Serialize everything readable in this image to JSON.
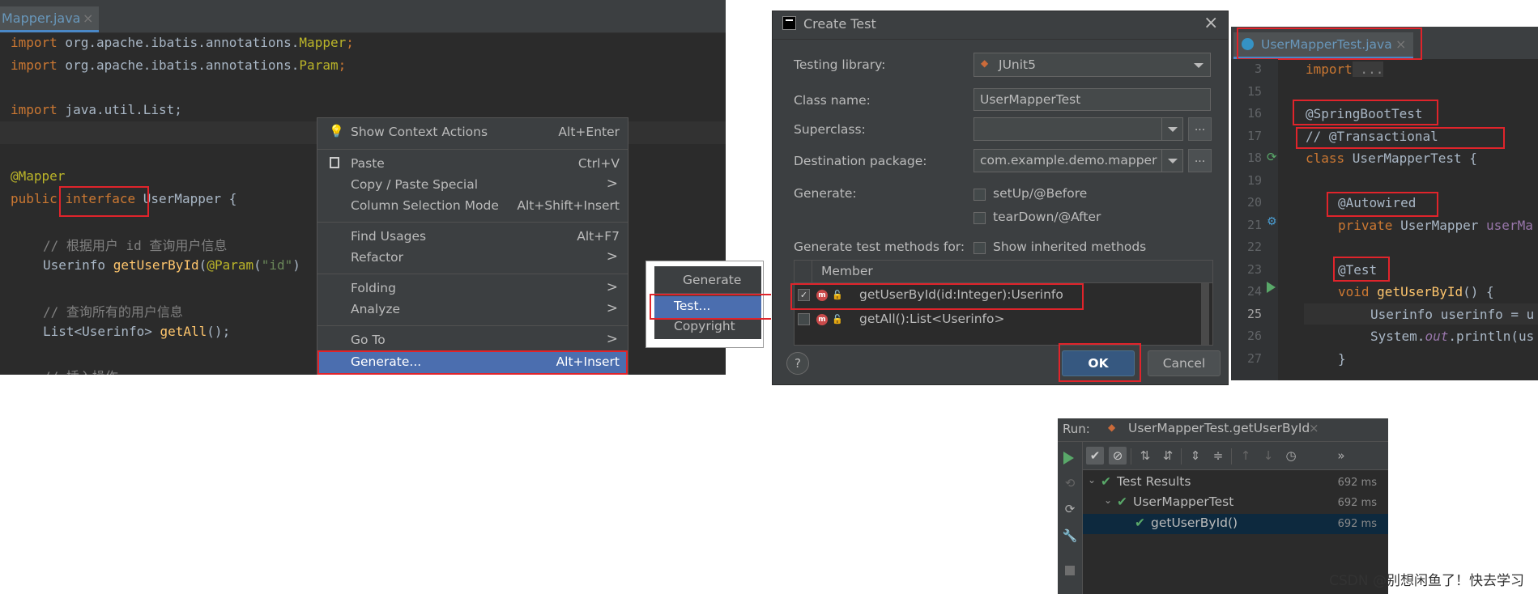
{
  "editor": {
    "tab_label": "Mapper.java",
    "tab_close": "×",
    "lines": {
      "l1_kw": "import",
      "l1_pkg": " org.apache.ibatis.annotations.",
      "l1_cls": "Mapper",
      "l1_end": ";",
      "l2_kw": "import",
      "l2_pkg": " org.apache.ibatis.annotations.",
      "l2_cls": "Param",
      "l2_end": ";",
      "l3_kw": "import",
      "l3_rest": " java.util.List;",
      "l4_ann": "@Mapper",
      "l5_kw": "public ",
      "l5_kw2": "interface",
      "l5_rest": " UserMapper {",
      "l6_cm": "// 根据用户 id 查询用户信息",
      "l7_type": "Userinfo ",
      "l7_fn": "getUserById",
      "l7_p": "(",
      "l7_ann": "@Param",
      "l7_p2": "(",
      "l7_str": "\"id\"",
      "l7_p3": ")",
      "l8_cm": "// 查询所有的用户信息",
      "l9_type": "List<Userinfo> ",
      "l9_fn": "getAll",
      "l9_end": "();",
      "l10_cm": "// 插入操作"
    }
  },
  "context_menu": {
    "items": [
      {
        "label": "Show Context Actions",
        "shortcut": "Alt+Enter"
      },
      {
        "label": "Paste",
        "shortcut": "Ctrl+V"
      },
      {
        "label": "Copy / Paste Special",
        "shortcut": ">"
      },
      {
        "label": "Column Selection Mode",
        "shortcut": "Alt+Shift+Insert"
      },
      {
        "label": "Find Usages",
        "shortcut": "Alt+F7"
      },
      {
        "label": "Refactor",
        "shortcut": ">"
      },
      {
        "label": "Folding",
        "shortcut": ">"
      },
      {
        "label": "Analyze",
        "shortcut": ">"
      },
      {
        "label": "Go To",
        "shortcut": ">"
      },
      {
        "label": "Generate...",
        "shortcut": "Alt+Insert"
      }
    ]
  },
  "generate_popup": {
    "title": "Generate",
    "items": [
      "Test...",
      "Copyright"
    ]
  },
  "dialog": {
    "title": "Create Test",
    "close": "×",
    "testing_library_label": "Testing library:",
    "testing_library_value": "JUnit5",
    "class_name_label": "Class name:",
    "class_name_value": "UserMapperTest",
    "superclass_label": "Superclass:",
    "superclass_value": "",
    "destination_label": "Destination package:",
    "destination_value": "com.example.demo.mapper",
    "ellipsis": "...",
    "generate_label": "Generate:",
    "setup_label": "setUp/@Before",
    "teardown_label": "tearDown/@After",
    "methods_label": "Generate test methods for:",
    "inherited_label": "Show inherited methods",
    "member_header": "Member",
    "members": [
      {
        "label": "getUserById(id:Integer):Userinfo",
        "checked": true
      },
      {
        "label": "getAll():List<Userinfo>",
        "checked": false
      }
    ],
    "help": "?",
    "ok_label": "OK",
    "cancel_label": "Cancel"
  },
  "test_editor": {
    "tab_label": "UserMapperTest.java",
    "tab_close": "×",
    "line_numbers": [
      "3",
      "15",
      "16",
      "17",
      "18",
      "19",
      "20",
      "21",
      "22",
      "23",
      "24",
      "25",
      "26",
      "27"
    ],
    "l3_kw": "import",
    "l3_fold": " ...",
    "l16": "@SpringBootTest",
    "l17": "// @Transactional",
    "l18_kw": "class ",
    "l18_rest": "UserMapperTest {",
    "l20": "@Autowired",
    "l21_kw": "private ",
    "l21_rest": "UserMapper ",
    "l21_var": "userMa",
    "l23": "@Test",
    "l24_kw": "void ",
    "l24_fn": "getUserById",
    "l24_rest": "() {",
    "l25": "Userinfo userinfo = u",
    "l26_a": "System.",
    "l26_b": "out",
    "l26_c": ".println(us",
    "l27": "}"
  },
  "run": {
    "label": "Run:",
    "tab_label": "UserMapperTest.getUserById",
    "tab_close": "×",
    "tree": [
      {
        "label": "Test Results",
        "time": "692 ms"
      },
      {
        "label": "UserMapperTest",
        "time": "692 ms"
      },
      {
        "label": "getUserById()",
        "time": "692 ms"
      }
    ]
  },
  "watermark": "CSDN @别想闲鱼了！快去学习"
}
